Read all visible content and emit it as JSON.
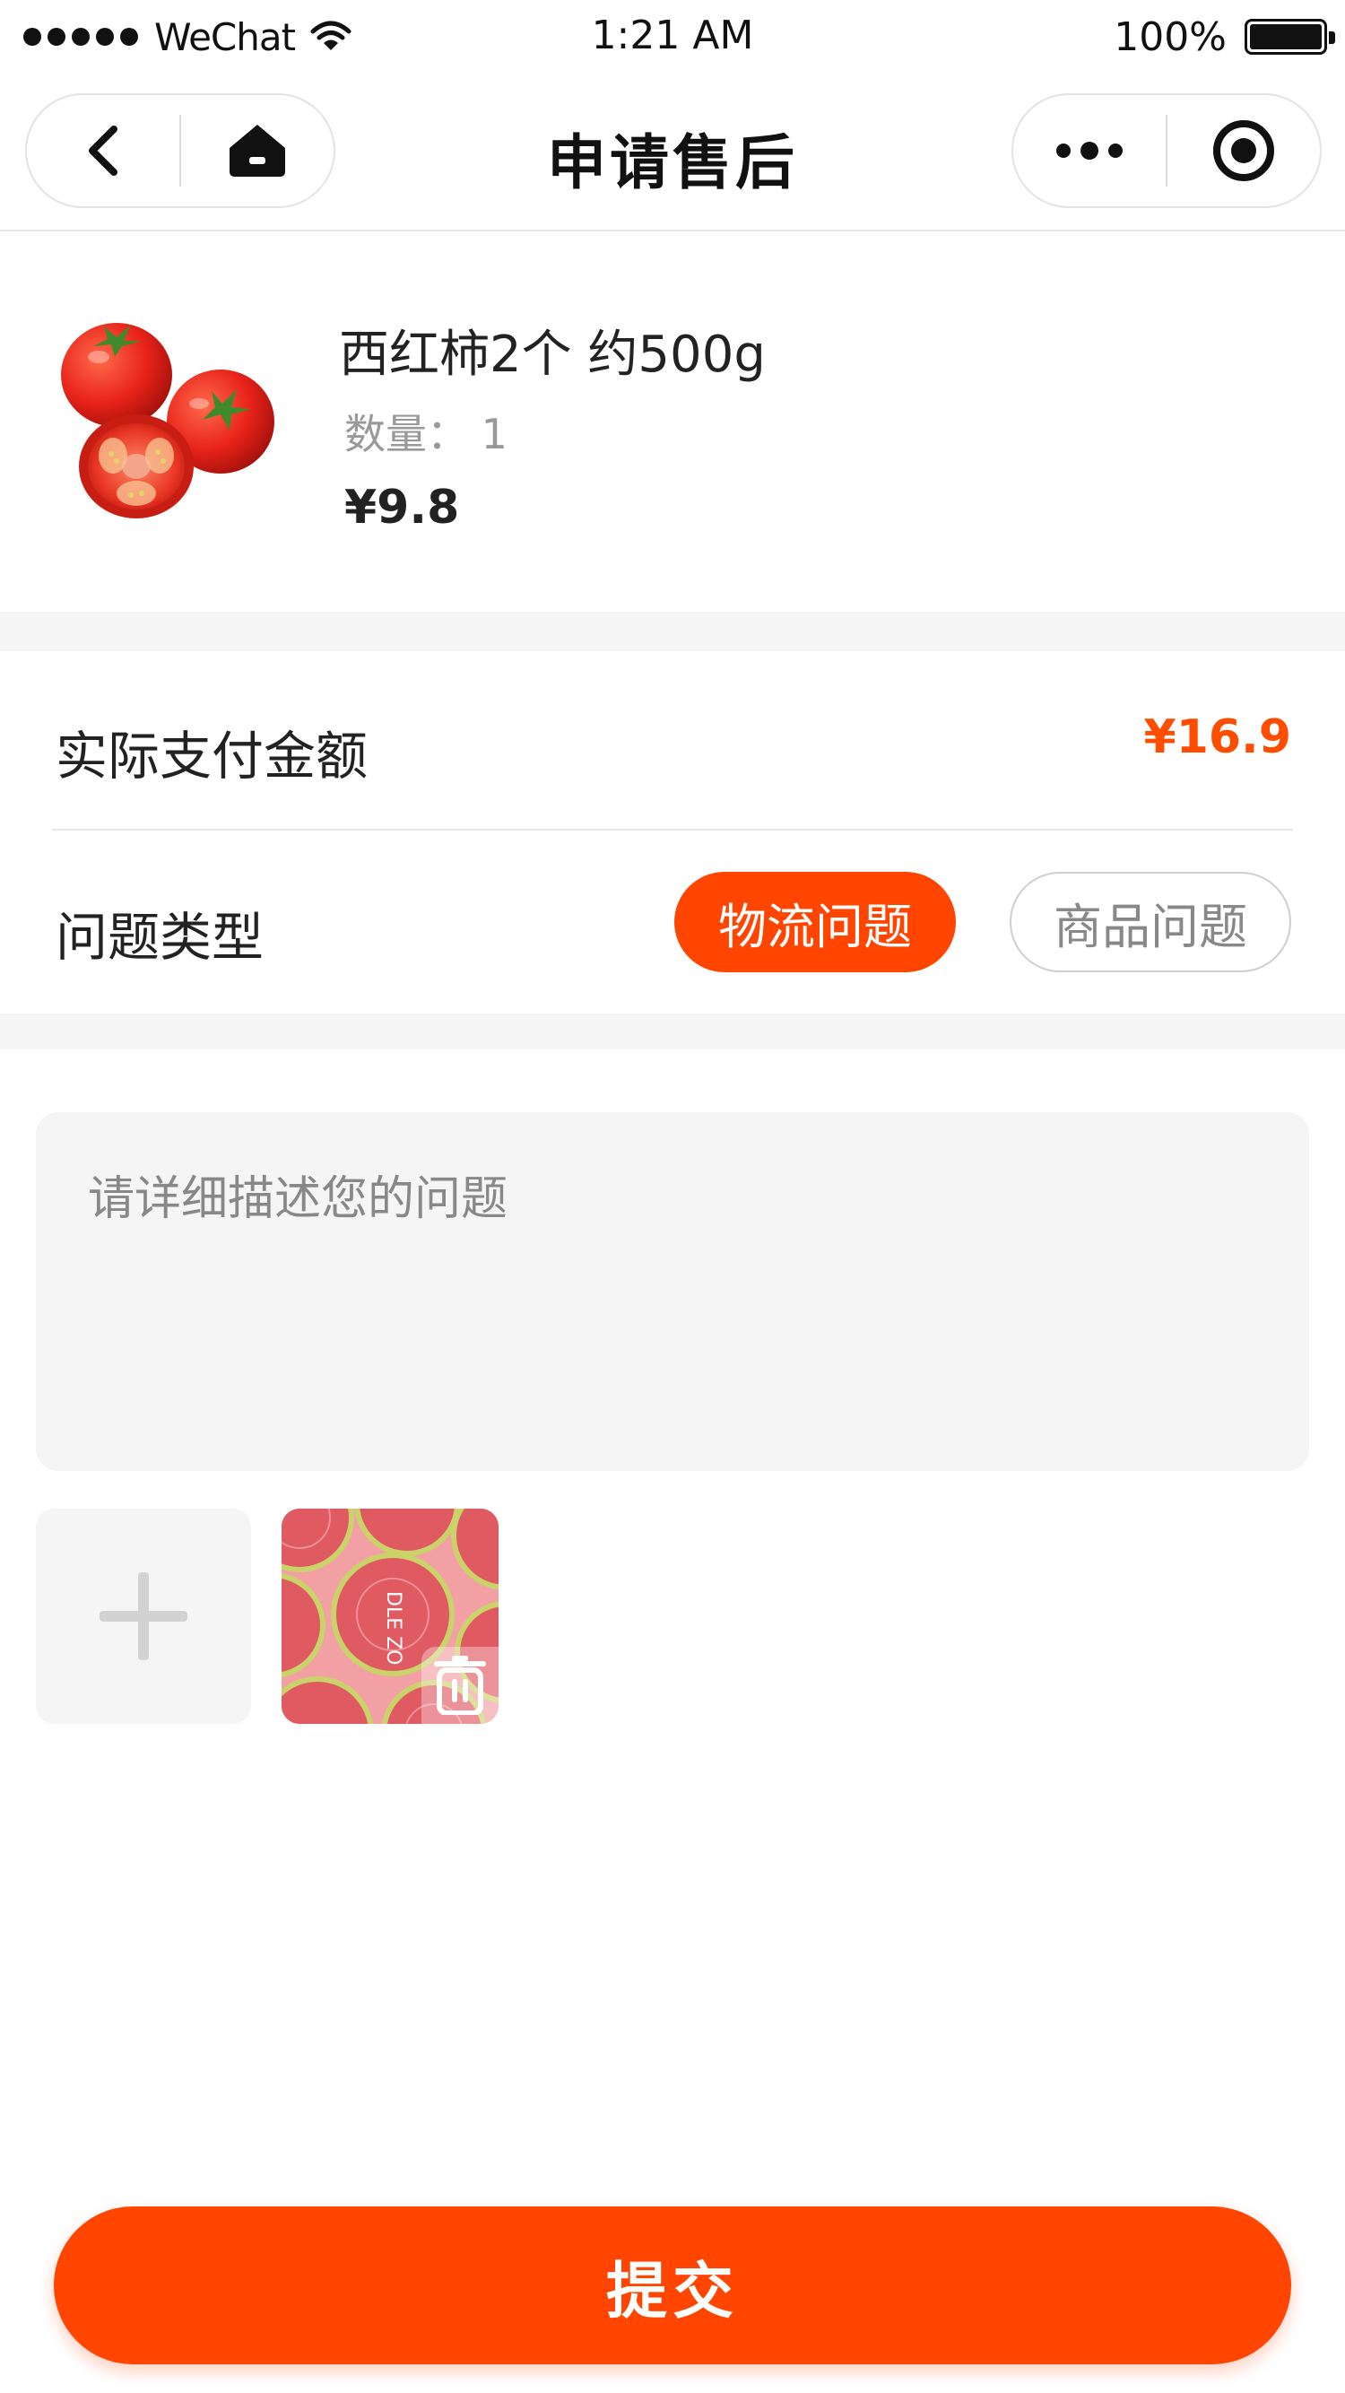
{
  "status_bar": {
    "carrier": "WeChat",
    "time": "1:21 AM",
    "battery": "100%",
    "icons": [
      "signal-icon",
      "wifi-icon",
      "battery-icon"
    ]
  },
  "nav": {
    "title": "申请售后",
    "icons": [
      "back-icon",
      "home-icon",
      "more-icon",
      "target-icon"
    ]
  },
  "product": {
    "name": "西红柿2个 约500g",
    "quantity": "数量： 1",
    "price": "¥9.8"
  },
  "payment": {
    "label": "实际支付金额",
    "amount": "¥16.9"
  },
  "issue_type": {
    "label": "问题类型",
    "options": [
      {
        "label": "物流问题",
        "selected": true
      },
      {
        "label": "商品问题",
        "selected": false
      }
    ]
  },
  "description": {
    "placeholder": "请详细描述您的问题",
    "value": ""
  },
  "photos": {
    "thumbnail_text": "DLE ZO"
  },
  "submit": {
    "label": "提交"
  },
  "colors": {
    "accent": "#ff4500",
    "background_band": "#f5f5f5"
  }
}
